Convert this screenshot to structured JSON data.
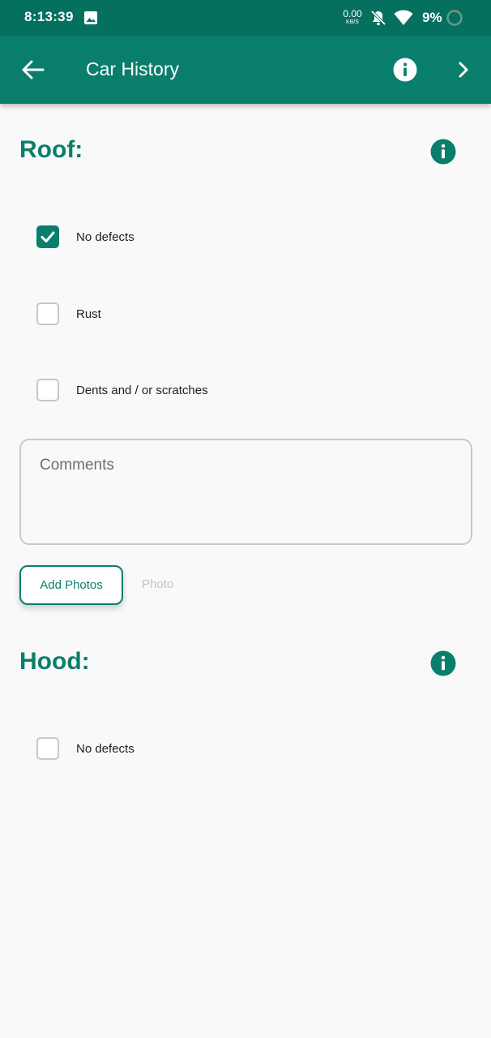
{
  "status_bar": {
    "time": "8:13:39",
    "speed_value": "0.00",
    "speed_unit": "KB/S",
    "battery": "9%"
  },
  "app_bar": {
    "title": "Car History",
    "back_icon": "arrow-left-icon",
    "info_icon": "info-icon",
    "next_icon": "chevron-right-icon"
  },
  "roof": {
    "title": "Roof:",
    "options": [
      {
        "label": "No defects",
        "checked": true
      },
      {
        "label": "Rust",
        "checked": false
      },
      {
        "label": "Dents and / or scratches",
        "checked": false
      }
    ],
    "comments_placeholder": "Comments",
    "add_photos_label": "Add Photos",
    "photo_label": "Photo"
  },
  "hood": {
    "title": "Hood:",
    "options": [
      {
        "label": "No defects",
        "checked": false
      }
    ]
  },
  "colors": {
    "accent": "#0a7e6c",
    "status_bar": "#06705f",
    "background": "#f9f9f9"
  }
}
